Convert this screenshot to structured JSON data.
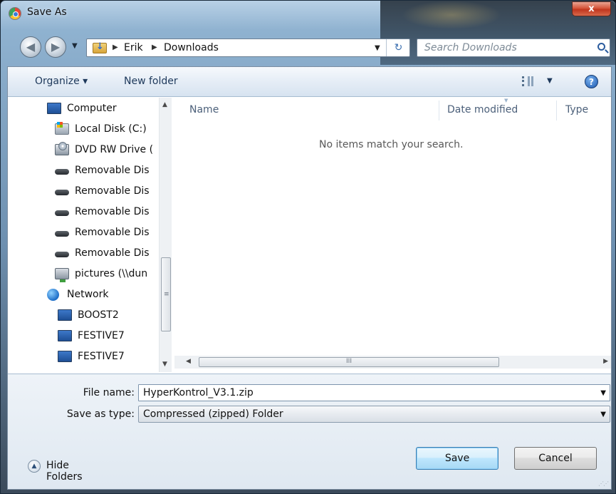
{
  "window": {
    "title": "Save As",
    "close_label": "x"
  },
  "address_bar": {
    "crumbs": [
      "Erik",
      "Downloads"
    ]
  },
  "search": {
    "placeholder": "Search Downloads"
  },
  "toolbar": {
    "organize_label": "Organize ▾",
    "new_folder_label": "New folder",
    "help_label": "?"
  },
  "nav_tree": {
    "items": [
      {
        "label": "Computer",
        "icon": "computer-icon"
      },
      {
        "label": "Local Disk (C:)",
        "icon": "local-disk-icon"
      },
      {
        "label": "DVD RW Drive (",
        "icon": "dvd-drive-icon"
      },
      {
        "label": "Removable Dis",
        "icon": "removable-disk-icon"
      },
      {
        "label": "Removable Dis",
        "icon": "removable-disk-icon"
      },
      {
        "label": "Removable Dis",
        "icon": "removable-disk-icon"
      },
      {
        "label": "Removable Dis",
        "icon": "removable-disk-icon"
      },
      {
        "label": "Removable Dis",
        "icon": "removable-disk-icon"
      },
      {
        "label": "pictures (\\\\dun",
        "icon": "network-drive-icon"
      },
      {
        "label": "Network",
        "icon": "network-icon"
      },
      {
        "label": "BOOST2",
        "icon": "computer-icon"
      },
      {
        "label": "FESTIVE7",
        "icon": "computer-icon"
      },
      {
        "label": "FESTIVE7",
        "icon": "computer-icon"
      }
    ]
  },
  "file_list": {
    "columns": [
      "Name",
      "Date modified",
      "Type"
    ],
    "empty_message": "No items match your search.",
    "hscroll_grip": "III"
  },
  "form": {
    "file_name_label": "File name:",
    "file_name_value": "HyperKontrol_V3.1.zip",
    "save_type_label": "Save as type:",
    "save_type_value": "Compressed (zipped) Folder"
  },
  "footer": {
    "hide_folders_label": "Hide Folders",
    "save_label": "Save",
    "cancel_label": "Cancel"
  }
}
